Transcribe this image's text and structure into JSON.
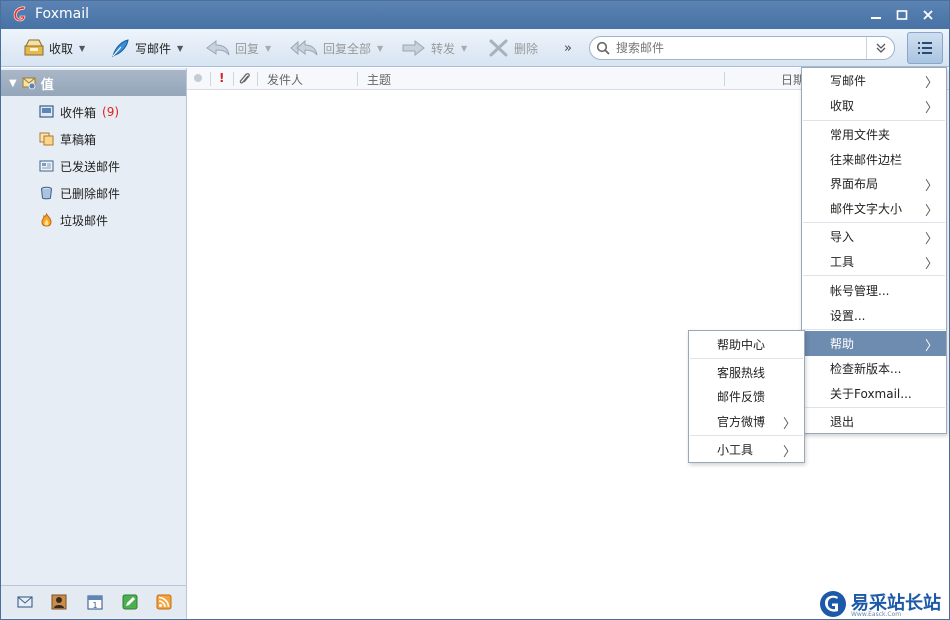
{
  "window": {
    "title": "Foxmail"
  },
  "toolbar": {
    "receive": "收取",
    "compose": "写邮件",
    "reply": "回复",
    "reply_all": "回复全部",
    "forward": "转发",
    "delete": "删除",
    "more": "»",
    "search_placeholder": "搜索邮件"
  },
  "sidebar": {
    "account": "值",
    "folders": [
      {
        "label": "收件箱",
        "count": "(9)",
        "icon": "inbox-icon"
      },
      {
        "label": "草稿箱",
        "icon": "drafts-icon"
      },
      {
        "label": "已发送邮件",
        "icon": "sent-icon"
      },
      {
        "label": "已删除邮件",
        "icon": "trash-icon"
      },
      {
        "label": "垃圾邮件",
        "icon": "junk-icon"
      }
    ]
  },
  "list_header": {
    "flag": "!",
    "sender": "发件人",
    "subject": "主题",
    "date": "日期"
  },
  "main_menu": {
    "items": [
      "写邮件",
      "收取",
      "常用文件夹",
      "往来邮件边栏",
      "界面布局",
      "邮件文字大小",
      "导入",
      "工具",
      "帐号管理...",
      "设置...",
      "帮助",
      "检查新版本...",
      "关于Foxmail...",
      "退出"
    ],
    "active": "帮助"
  },
  "help_submenu": {
    "items": [
      "帮助中心",
      "客服热线",
      "邮件反馈",
      "官方微博",
      "小工具"
    ]
  },
  "watermark": {
    "text": "易采站长站",
    "small": "Www.Easck.Com"
  },
  "colors": {
    "titlebar": "#4d77a9",
    "menu_active": "#6d8cb0",
    "unread_count": "#e02020"
  }
}
